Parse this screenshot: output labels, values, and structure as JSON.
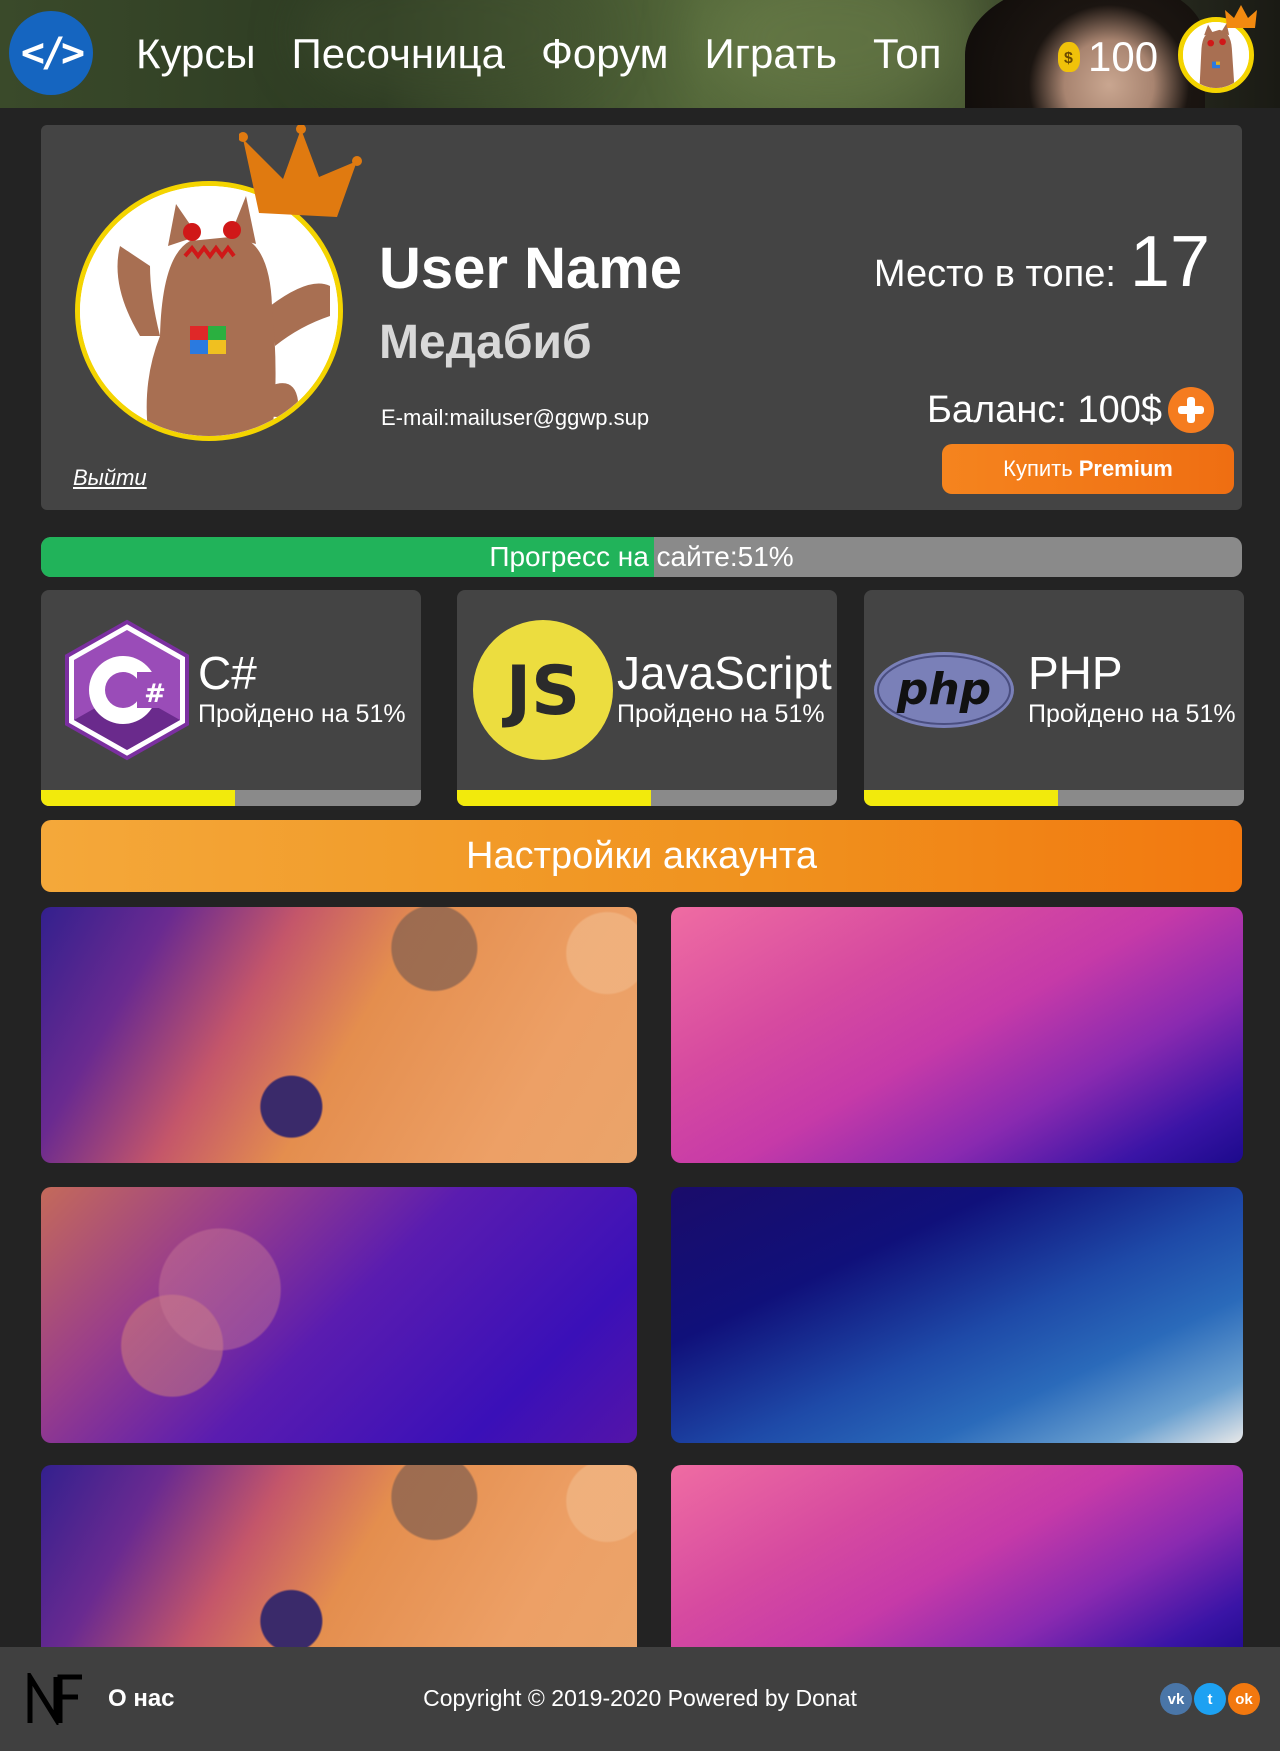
{
  "header": {
    "logo_text": "</>",
    "nav": [
      "Курсы",
      "Песочница",
      "Форум",
      "Играть",
      "Топ"
    ],
    "coins": "100"
  },
  "profile": {
    "user_name": "User Name",
    "nickname": "Медабиб",
    "email": "E-mail:mailuser@ggwp.sup",
    "logout": "Выйти",
    "rank_label": "Место в топе:",
    "rank_value": "17",
    "balance": "Баланс: 100$",
    "premium_prefix": "Купить",
    "premium_bold": "Premium"
  },
  "site_progress": {
    "label": "Прогресс на сайте:51%",
    "percent": 51
  },
  "courses": [
    {
      "name": "C#",
      "status": "Пройдено на 51%",
      "percent": 51,
      "icon": "csharp-logo-icon"
    },
    {
      "name": "JavaScript",
      "status": "Пройдено на 51%",
      "percent": 51,
      "icon": "javascript-logo-icon"
    },
    {
      "name": "PHP",
      "status": "Пройдено на 51%",
      "percent": 51,
      "icon": "php-logo-icon"
    }
  ],
  "settings": {
    "label": "Настройки аккаунта"
  },
  "footer": {
    "logo_text": "NF",
    "about": "О нас",
    "copyright": "Copyright © 2019-2020 Powered by Donat",
    "social": [
      "vk-icon",
      "twitter-icon",
      "odnoklassniki-icon"
    ]
  },
  "colors": {
    "accent_orange": "#f5841e",
    "progress_green": "#21b35a",
    "course_yellow": "#f2ea0c",
    "avatar_border": "#f4d400",
    "logo_blue": "#1565c0"
  }
}
